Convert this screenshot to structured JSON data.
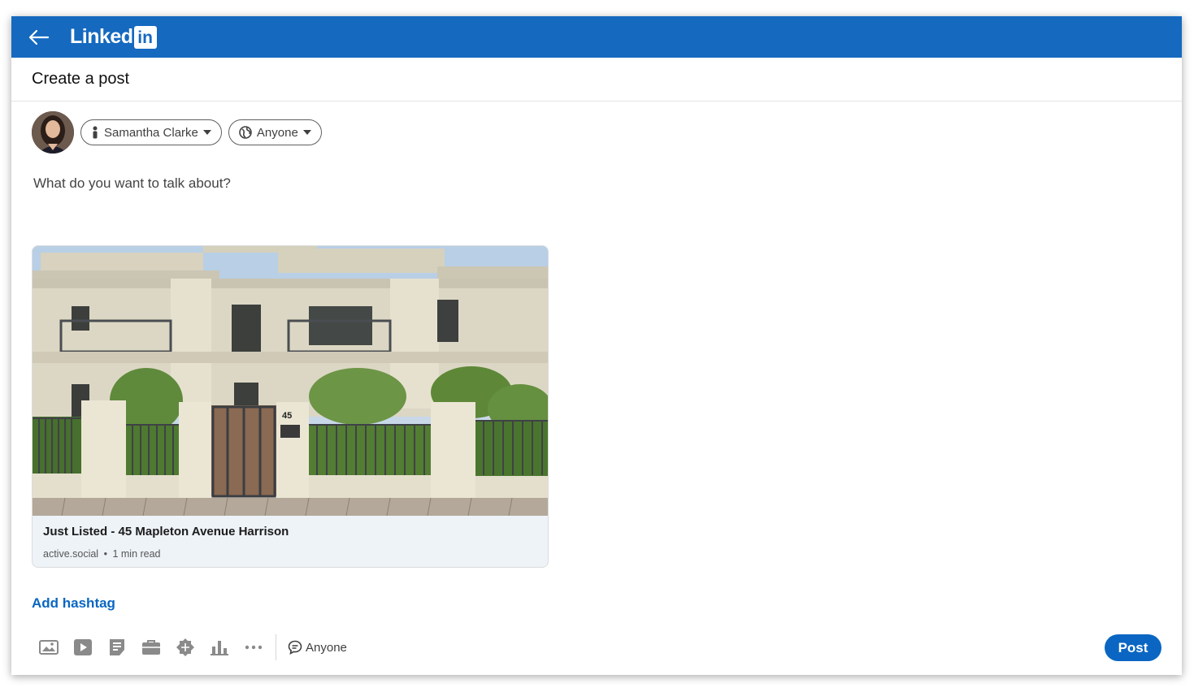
{
  "brand": {
    "name": "Linked",
    "mark": "in",
    "color": "#1569bf"
  },
  "header": {
    "title": "Create a post"
  },
  "author": {
    "name": "Samantha Clarke",
    "audience": "Anyone"
  },
  "composer": {
    "placeholder": "What do you want to talk about?"
  },
  "link_card": {
    "title": "Just Listed - 45 Mapleton Avenue Harrison",
    "source": "active.social",
    "separator": "•",
    "read_time": "1 min read",
    "house_number": "45"
  },
  "add_hashtag_label": "Add hashtag",
  "toolbar": {
    "icons": [
      "photo-icon",
      "video-icon",
      "document-icon",
      "briefcase-icon",
      "badge-icon",
      "poll-icon",
      "more-icon"
    ],
    "comment_setting": "Anyone"
  },
  "post_button_label": "Post",
  "accent_color": "#0a66c2"
}
